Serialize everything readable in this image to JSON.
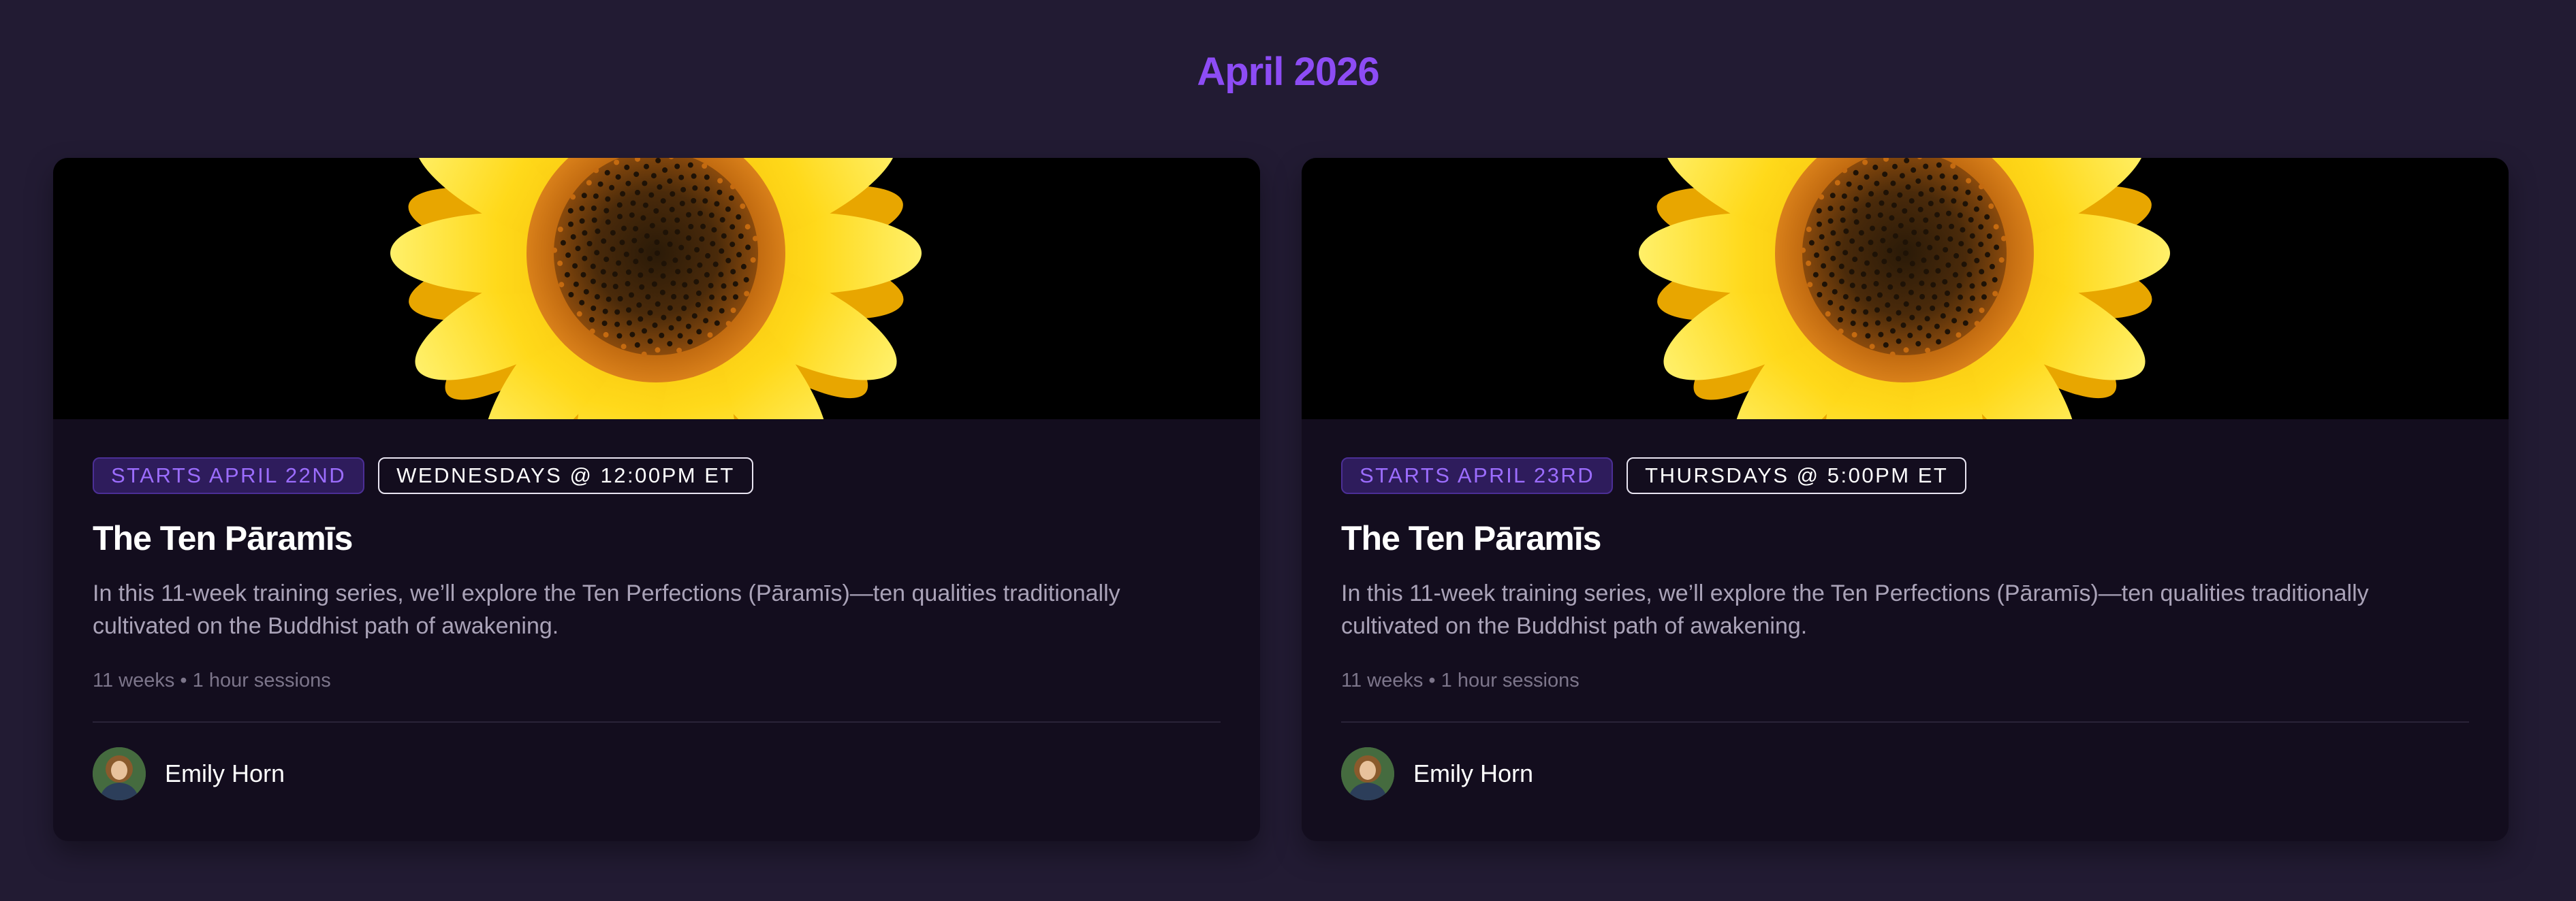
{
  "page": {
    "month_title": "April 2026"
  },
  "colors": {
    "background": "#221b33",
    "card": "#130d1e",
    "accent": "#8d4cf5"
  },
  "courses": [
    {
      "start_label": "STARTS APRIL 22ND",
      "schedule_label": "WEDNESDAYS @ 12:00PM ET",
      "title": "The Ten Pāramīs",
      "description": "In this 11-week training series, we’ll explore the Ten Perfections (Pāramīs)—ten qualities traditionally cultivated on the Buddhist path of awakening.",
      "meta": "11 weeks • 1 hour sessions",
      "teacher_name": "Emily Horn",
      "image_icon": "sunflower-image"
    },
    {
      "start_label": "STARTS APRIL 23RD",
      "schedule_label": "THURSDAYS @ 5:00PM ET",
      "title": "The Ten Pāramīs",
      "description": "In this 11-week training series, we’ll explore the Ten Perfections (Pāramīs)—ten qualities traditionally cultivated on the Buddhist path of awakening.",
      "meta": "11 weeks • 1 hour sessions",
      "teacher_name": "Emily Horn",
      "image_icon": "sunflower-image"
    }
  ]
}
